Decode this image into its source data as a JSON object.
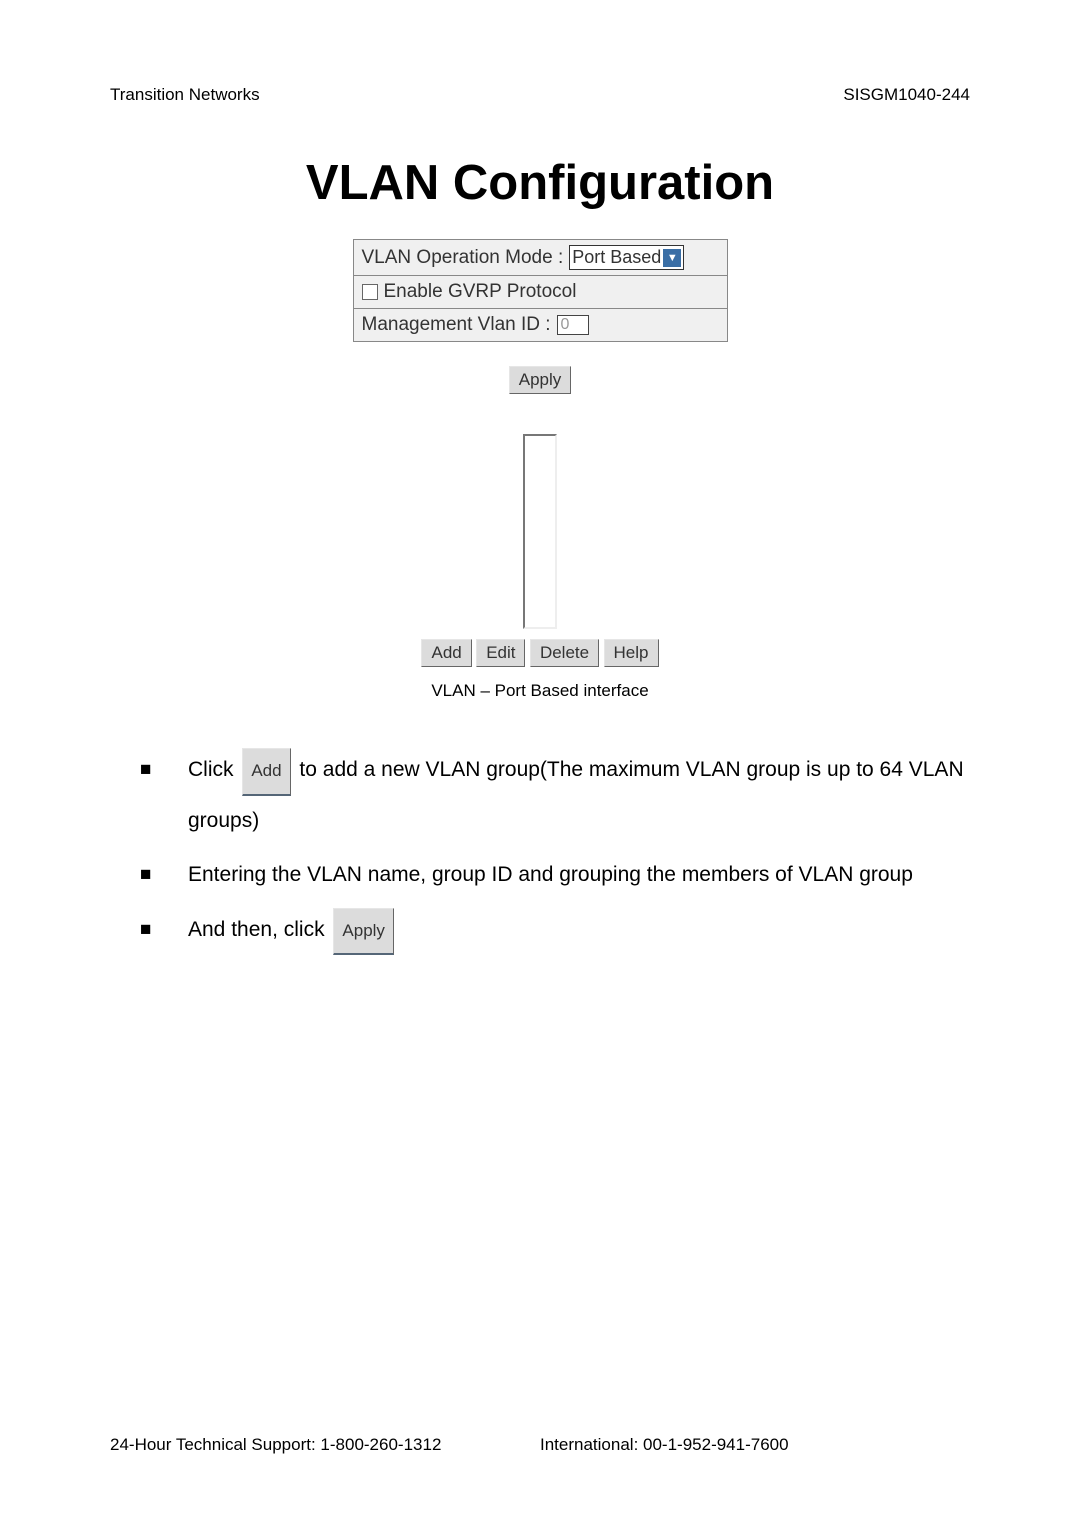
{
  "header": {
    "left": "Transition Networks",
    "right": "SISGM1040-244"
  },
  "title": "VLAN Configuration",
  "config": {
    "row1_label": "VLAN Operation Mode :",
    "row1_dropdown_value": "Port Based",
    "row2_label": "Enable GVRP Protocol",
    "row3_label": "Management Vlan ID :",
    "row3_input_value": "0"
  },
  "buttons": {
    "apply": "Apply",
    "add": "Add",
    "edit": "Edit",
    "delete": "Delete",
    "help": "Help"
  },
  "caption": "VLAN – Port Based interface",
  "instructions": {
    "item1_prefix": "Click ",
    "item1_button": "Add",
    "item1_suffix": " to add a new VLAN group(The maximum VLAN group is up to 64 VLAN groups)",
    "item2": "Entering the VLAN name, group ID and grouping the members of VLAN group",
    "item3_prefix": "And then, click ",
    "item3_button": "Apply"
  },
  "footer": {
    "left": "24-Hour Technical Support: 1-800-260-1312",
    "right": "International: 00-1-952-941-7600"
  }
}
